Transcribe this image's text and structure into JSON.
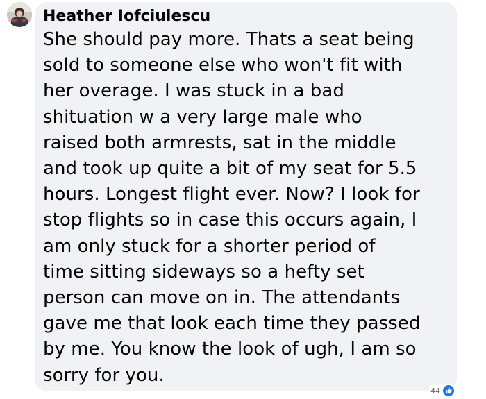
{
  "comment": {
    "author": "Heather Iofciulescu",
    "avatar_icon": "profile-photo",
    "text": "She should pay more. Thats a seat being\nsold to someone else who won't fit with\nher overage. I was stuck in a bad\nshituation w a very large male who\nraised both armrests, sat in the middle\nand took up quite a bit of my seat for 5.5\nhours. Longest flight ever. Now? I look for\nstop flights so in case this occurs again, I\nam only stuck for a shorter period of\ntime sitting sideways so a hefty set\nperson can move on in. The attendants\ngave me that look each time they passed\nby me. You know the look of ugh, I am so\nsorry for you.",
    "reactions": {
      "count": "44",
      "icon": "like-icon"
    }
  },
  "colors": {
    "bubble_bg": "#f0f2f5",
    "text": "#050505",
    "muted": "#65676b",
    "like_blue": "#1877f2"
  }
}
